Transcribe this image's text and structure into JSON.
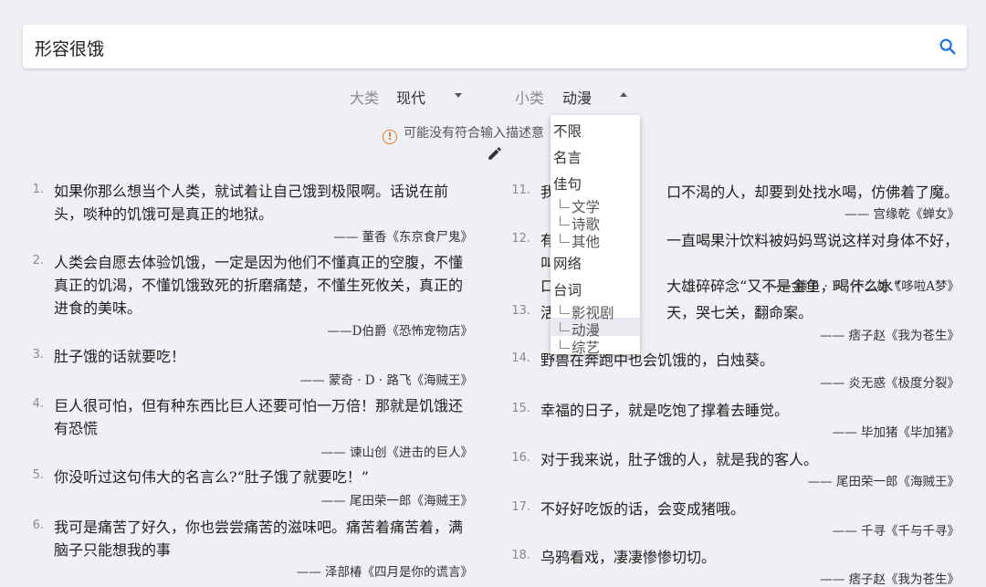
{
  "search": {
    "query": "形容很饿"
  },
  "filters": {
    "major_label": "大类",
    "major_value": "现代",
    "minor_label": "小类",
    "minor_value": "动漫"
  },
  "warning": {
    "text": "可能没有符合输入描述意"
  },
  "dropdown": {
    "items": [
      "不限",
      "名言",
      "佳句",
      "文学",
      "诗歌",
      "其他",
      "网络",
      "台词",
      "影视剧",
      "动漫",
      "综艺"
    ],
    "selected": "动漫"
  },
  "left_quotes": [
    {
      "num": "1.",
      "lines": [
        "如果你那么想当个人类，就试着让自己饿到极限啊。话说在前",
        "头，啖种的饥饿可是真正的地狱。"
      ],
      "source": "—— 董香《东京食尸鬼》"
    },
    {
      "num": "2.",
      "lines": [
        "人类会自愿去体验饥饿，一定是因为他们不懂真正的空腹，不懂",
        "真正的饥渴，不懂饥饿致死的折磨痛楚，不懂生死攸关，真正的",
        "进食的美味。"
      ],
      "source": "——D伯爵《恐怖宠物店》"
    },
    {
      "num": "3.",
      "lines": [
        "肚子饿的话就要吃！"
      ],
      "source": "—— 蒙奇 · D · 路飞《海贼王》"
    },
    {
      "num": "4.",
      "lines": [
        "巨人很可怕，但有种东西比巨人还要可怕一万倍！那就是饥饿还",
        "有恐慌"
      ],
      "source": "—— 谏山创《进击的巨人》"
    },
    {
      "num": "5.",
      "lines": [
        "你没听过这句伟大的名言么?“肚子饿了就要吃！”"
      ],
      "source": "—— 尾田荣一郎《海贼王》"
    },
    {
      "num": "6.",
      "lines": [
        "我可是痛苦了好久，你也尝尝痛苦的滋味吧。痛苦着痛苦着，满",
        "脑子只能想我的事"
      ],
      "source": "—— 泽部椿《四月是你的谎言》"
    }
  ],
  "right_quotes": [
    {
      "num": "11.",
      "lines": [
        "我 　　　　　　　 口不渴的人，却要到处找水喝，仿佛着了魔。"
      ],
      "source": "—— 宫缘乾《蝉女》"
    },
    {
      "num": "12.",
      "lines": [
        "有 　　　　　　　 一直喝果汁饮料被妈妈骂说这样对身体不好，叫他",
        "口 　　　　　　　 大雄碎碎念“又不是金鱼，喝什么水”"
      ],
      "source": "—— 藤子 · F · 不二雄《哆啦A梦》"
    },
    {
      "num": "13.",
      "lines": [
        "活 　　　　　　　 天，哭七关，翻命案。"
      ],
      "source": "—— 痞子赵《我为苍生》"
    },
    {
      "num": "14.",
      "lines": [
        "野兽在奔跑中也会饥饿的，白烛葵。"
      ],
      "source": "—— 炎无惑《极度分裂》"
    },
    {
      "num": "15.",
      "lines": [
        "幸福的日子，就是吃饱了撑着去睡觉。"
      ],
      "source": "—— 毕加猪《毕加猪》"
    },
    {
      "num": "16.",
      "lines": [
        "对于我来说，肚子饿的人，就是我的客人。"
      ],
      "source": "—— 尾田荣一郎《海贼王》"
    },
    {
      "num": "17.",
      "lines": [
        "不好好吃饭的话，会变成猪哦。"
      ],
      "source": "—— 千寻《千与千寻》"
    },
    {
      "num": "18.",
      "lines": [
        "乌鸦看戏，凄凄惨惨切切。"
      ],
      "source": "—— 痞子赵《我为苍生》"
    }
  ]
}
